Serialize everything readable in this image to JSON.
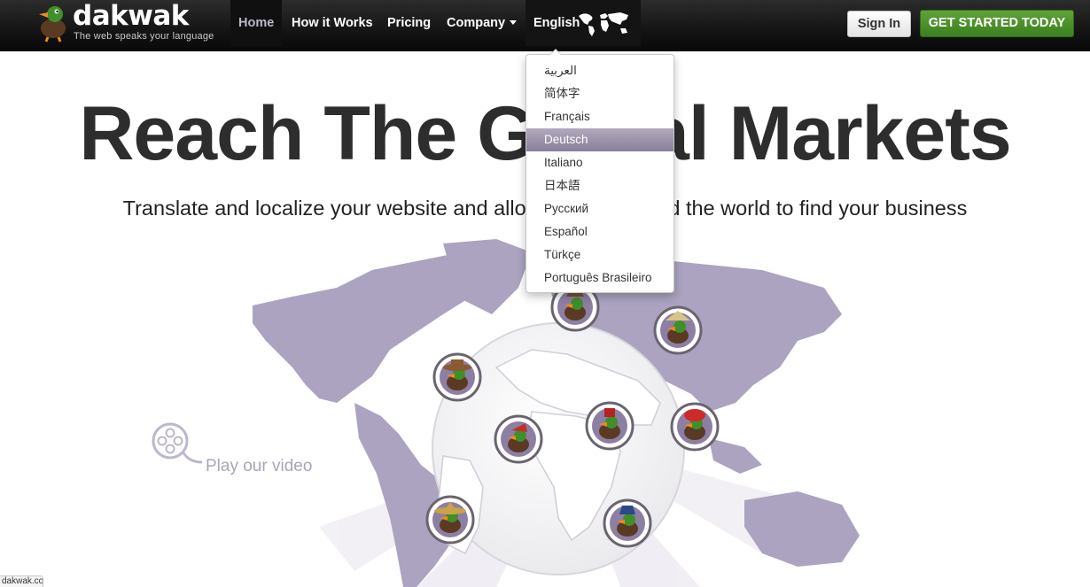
{
  "brand": {
    "name": "dakwak",
    "tagline": "The web speaks your language"
  },
  "nav": {
    "home": "Home",
    "how_it_works": "How it Works",
    "pricing": "Pricing",
    "company": "Company",
    "language": "English",
    "sign_in": "Sign In",
    "get_started": "GET STARTED TODAY"
  },
  "hero": {
    "title": "Reach The Global Markets",
    "subtitle": "Translate and localize your website and allow people around the world to find your business"
  },
  "video": {
    "label": "Play our video"
  },
  "language_menu": {
    "selected": "Deutsch",
    "items": [
      {
        "label": "العربية"
      },
      {
        "label": "简体字"
      },
      {
        "label": "Français"
      },
      {
        "label": "Deutsch"
      },
      {
        "label": "Italiano"
      },
      {
        "label": "日本語"
      },
      {
        "label": "Русский"
      },
      {
        "label": "Español"
      },
      {
        "label": "Türkçe"
      },
      {
        "label": "Português Brasileiro"
      }
    ]
  },
  "status_bar": {
    "url": "dakwak.com"
  },
  "colors": {
    "nav_bg": "#111111",
    "accent_purple": "#aca5bf",
    "cta_green": "#4a8f2a"
  }
}
